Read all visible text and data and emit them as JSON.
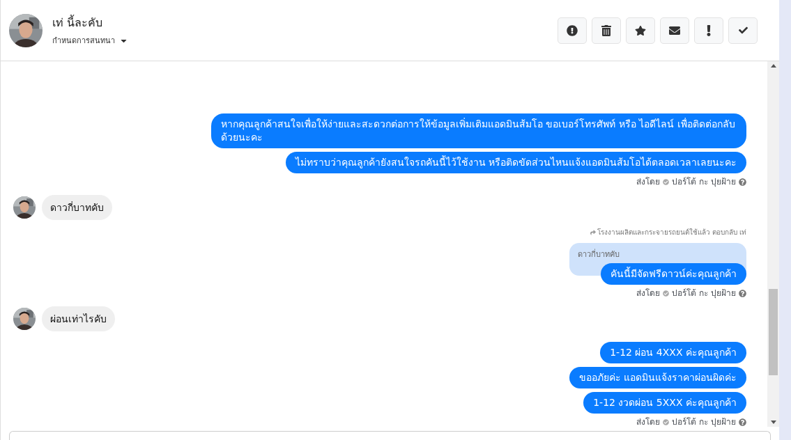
{
  "header": {
    "name": "เท่ นี้ละคับ",
    "assign_label": "กำหนดการสนทนา"
  },
  "toolbar": [
    {
      "kind": "alert"
    },
    {
      "kind": "trash"
    },
    {
      "kind": "star"
    },
    {
      "kind": "mail"
    },
    {
      "kind": "exclaim"
    },
    {
      "kind": "check"
    }
  ],
  "messages": [
    {
      "kind": "outgoing",
      "text": "หากคุณลูกค้าสนใจเพื่อให้ง่ายและสะดวกต่อการให้ข้อมูลเพิ่มเติมแอดมินส้มโอ ขอเบอร์โทรศัพท์ หรือ ไอดีไลน์ เพื่อติดต่อกลับด้วยนะคะ"
    },
    {
      "kind": "outgoing",
      "text": "ไม่ทราบว่าคุณลูกค้ายังสนใจรถคันนี้ไว้ใช้งาน หรือติดขัดส่วนไหนแจ้งแอดมินส้มโอได้ตลอดเวลาเลยนะคะ"
    },
    {
      "kind": "sent_by",
      "label": "ส่งโดย",
      "sender": "ปอร์โต้ กะ ปุยฝ้าย"
    },
    {
      "kind": "incoming",
      "text": "ดาวกี่บาทคับ"
    },
    {
      "kind": "reply",
      "context": "โรงงานผลิตและกระจายรถยนต์ใช้แล้ว ตอบกลับ เท่",
      "quoted": "ดาวกี่บาทคับ",
      "text": "คันนี้มีจัดฟรีดาวน์ค่ะคุณลูกค้า"
    },
    {
      "kind": "sent_by",
      "label": "ส่งโดย",
      "sender": "ปอร์โต้ กะ ปุยฝ้าย"
    },
    {
      "kind": "incoming",
      "text": "ผ่อนเท่าไรคับ"
    },
    {
      "kind": "outgoing",
      "text": "1-12 ผ่อน 4XXX ค่ะคุณลูกค้า"
    },
    {
      "kind": "outgoing",
      "text": "ขออภัยค่ะ แอดมินแจ้งราคาผ่อนผิดค่ะ"
    },
    {
      "kind": "outgoing",
      "text": "1-12 งวดผ่อน 5XXX ค่ะคุณลูกค้า"
    },
    {
      "kind": "sent_by",
      "label": "ส่งโดย",
      "sender": "ปอร์โต้ กะ ปุยฝ้าย"
    }
  ]
}
